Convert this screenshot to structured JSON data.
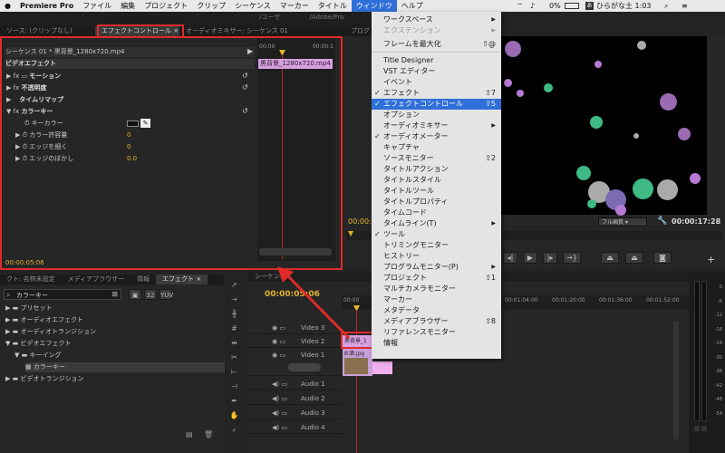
{
  "menubar": {
    "apple": "",
    "app": "Premiere Pro",
    "items": [
      "ファイル",
      "編集",
      "プロジェクト",
      "クリップ",
      "シーケンス",
      "マーカー",
      "タイトル",
      "ウィンドウ",
      "ヘルプ"
    ],
    "battery": "0%",
    "input": "ひらがな",
    "time": "土 1:03"
  },
  "effect_controls": {
    "tabs": [
      "ソース: (クリップなし)",
      "エフェクトコントロール ×",
      "オーディオミキサー: シーケンス 01"
    ],
    "sequence": "シーケンス 01 * 黒背景_1280x720.mp4",
    "clip_label": "黒背景_1280x720.mp4",
    "ruler_start": "00:00",
    "ruler_end": "00:00:1",
    "section": "ビデオエフェクト",
    "rows": [
      "モーション",
      "不透明度",
      "タイムリマップ",
      "カラーキー"
    ],
    "params": [
      "キーカラー",
      "カラー許容量",
      "エッジを細く",
      "エッジのぼかし"
    ],
    "values": [
      "",
      "0",
      "0",
      "0.0"
    ],
    "timecode": "00:00:05:06"
  },
  "program": {
    "tab": "プログ",
    "path_a": "/ユーザ",
    "path_b": "/Adobe/Pro",
    "timecode_left": "00:00:",
    "quality": "フル画質",
    "timecode_right": "00:00:17:28"
  },
  "project": {
    "tabs": [
      "クト: 名称未設定",
      "メディアブラウザー",
      "情報",
      "エフェクト ×"
    ],
    "search": "カラーキー",
    "items": [
      "プリセット",
      "オーディオエフェクト",
      "オーディオトランジション",
      "ビデオエフェクト",
      "キーイング",
      "カラーキー",
      "ビデオトランジション"
    ]
  },
  "timeline": {
    "tab": "シーケンス",
    "timecode": "00:00:05:06",
    "ruler": [
      "00:00",
      "00:01:04:00",
      "00:01:20:00",
      "00:01:36:00",
      "00:01:52:00"
    ],
    "tracks": [
      "Video 3",
      "Video 2",
      "Video 1",
      "Audio 1",
      "Audio 2",
      "Audio 3",
      "Audio 4"
    ],
    "clip_v2": "黒背景_1",
    "clip_v1": "お酒.jpg"
  },
  "meters": [
    "0",
    "-6",
    "-12",
    "-18",
    "-24",
    "-30",
    "-36",
    "-42",
    "-48",
    "-54"
  ],
  "menu": {
    "items": [
      {
        "label": "ワークスペース",
        "arrow": "▶",
        "sc": ""
      },
      {
        "label": "エクステンション",
        "arrow": "▶",
        "sc": "",
        "dis": true
      },
      {
        "label": "フレームを最大化",
        "sc": "⇧@"
      },
      {
        "label": "Title Designer",
        "sc": ""
      },
      {
        "label": "VST エディター",
        "sc": ""
      },
      {
        "label": "イベント",
        "sc": ""
      },
      {
        "label": "エフェクト",
        "check": "✓",
        "sc": "⇧7"
      },
      {
        "label": "エフェクトコントロール",
        "check": "✓",
        "sc": "⇧5",
        "sel": true
      },
      {
        "label": "オプション",
        "sc": ""
      },
      {
        "label": "オーディオミキサー",
        "arrow": "▶",
        "sc": ""
      },
      {
        "label": "オーディオメーター",
        "check": "✓",
        "sc": ""
      },
      {
        "label": "キャプチャ",
        "sc": ""
      },
      {
        "label": "ソースモニター",
        "arrow": "",
        "sc": "⇧2"
      },
      {
        "label": "タイトルアクション",
        "sc": ""
      },
      {
        "label": "タイトルスタイル",
        "sc": ""
      },
      {
        "label": "タイトルツール",
        "sc": ""
      },
      {
        "label": "タイトルプロパティ",
        "sc": ""
      },
      {
        "label": "タイムコード",
        "sc": ""
      },
      {
        "label": "タイムライン(T)",
        "arrow": "▶",
        "sc": ""
      },
      {
        "label": "ツール",
        "check": "✓",
        "sc": ""
      },
      {
        "label": "トリミングモニター",
        "sc": ""
      },
      {
        "label": "ヒストリー",
        "sc": ""
      },
      {
        "label": "プログラムモニター(P)",
        "arrow": "▶",
        "sc": ""
      },
      {
        "label": "プロジェクト",
        "sc": "⇧1"
      },
      {
        "label": "マルチカメラモニター",
        "sc": ""
      },
      {
        "label": "マーカー",
        "sc": ""
      },
      {
        "label": "メタデータ",
        "sc": ""
      },
      {
        "label": "メディアブラウザー",
        "sc": "⇧8"
      },
      {
        "label": "リファレンスモニター",
        "sc": ""
      },
      {
        "label": "情報",
        "sc": ""
      }
    ]
  },
  "colors": {
    "accent": "#2f6fd8",
    "highlight": "#e12b2b",
    "timecode": "#e0b32a",
    "clip": "#d6a0e0"
  }
}
